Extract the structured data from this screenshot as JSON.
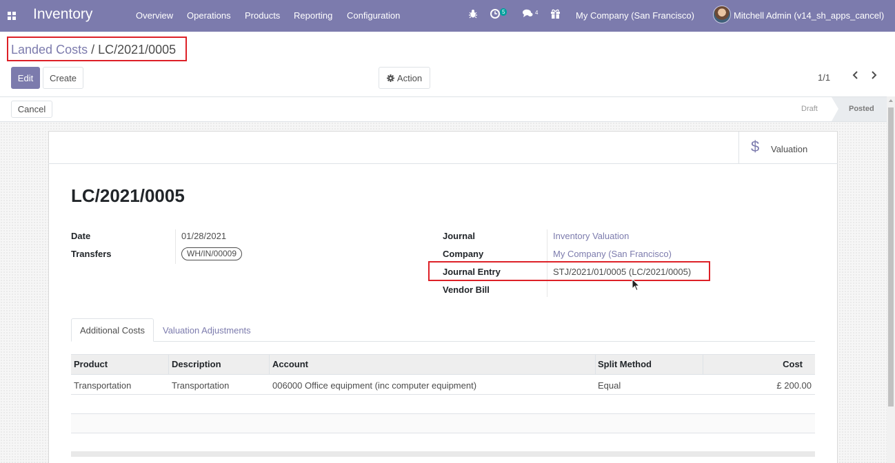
{
  "navbar": {
    "app_title": "Inventory",
    "menu": [
      "Overview",
      "Operations",
      "Products",
      "Reporting",
      "Configuration"
    ],
    "activity_count": "5",
    "message_count": "4",
    "company": "My Company (San Francisco)",
    "user": "Mitchell Admin (v14_sh_apps_cancel)",
    "accent_color": "#7c7bad"
  },
  "breadcrumb": {
    "parent": "Landed Costs",
    "separator": " / ",
    "current": "LC/2021/0005"
  },
  "buttons": {
    "edit": "Edit",
    "create": "Create",
    "action": "Action",
    "cancel": "Cancel"
  },
  "pager": {
    "value": "1/1"
  },
  "status": {
    "draft": "Draft",
    "posted": "Posted",
    "current": "Posted"
  },
  "smart_button": {
    "icon": "dollar-icon",
    "label": "Valuation"
  },
  "record": {
    "title": "LC/2021/0005",
    "date_label": "Date",
    "date": "01/28/2021",
    "transfers_label": "Transfers",
    "transfers": "WH/IN/00009",
    "journal_label": "Journal",
    "journal": "Inventory Valuation",
    "company_label": "Company",
    "company": "My Company (San Francisco)",
    "journal_entry_label": "Journal Entry",
    "journal_entry": "STJ/2021/01/0005 (LC/2021/0005)",
    "vendor_bill_label": "Vendor Bill",
    "vendor_bill": ""
  },
  "tabs": [
    "Additional Costs",
    "Valuation Adjustments"
  ],
  "cost_table": {
    "columns": [
      "Product",
      "Description",
      "Account",
      "Split Method",
      "Cost"
    ],
    "rows": [
      {
        "product": "Transportation",
        "description": "Transportation",
        "account": "006000 Office equipment (inc computer equipment)",
        "split_method": "Equal",
        "cost": "£ 200.00"
      }
    ]
  }
}
